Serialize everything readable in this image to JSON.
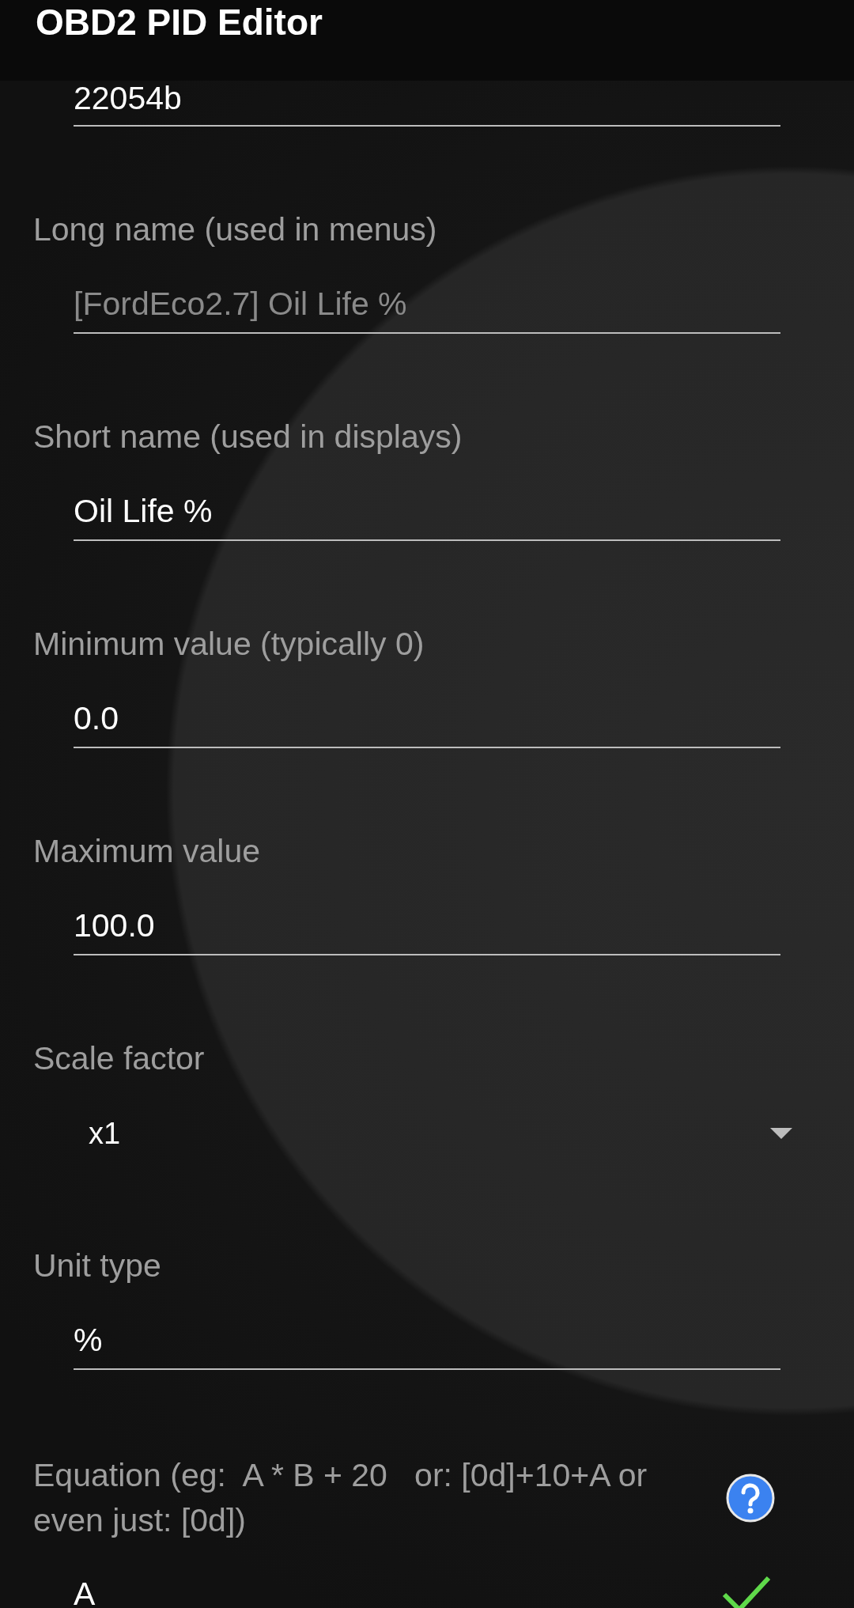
{
  "window": {
    "title": "OBD2 PID Editor"
  },
  "fields": [
    {
      "kind": "text",
      "value": "22054b"
    },
    {
      "kind": "text",
      "label": "Long name (used in menus)",
      "placeholder": "[FordEco2.7] Oil Life %"
    },
    {
      "kind": "text",
      "label": "Short name (used in displays)",
      "value": "Oil Life %"
    },
    {
      "kind": "text",
      "label": "Minimum value (typically 0)",
      "value": "0.0"
    },
    {
      "kind": "text",
      "label": "Maximum value",
      "value": "100.0"
    },
    {
      "kind": "dropdown",
      "label": "Scale factor",
      "value": "x1"
    },
    {
      "kind": "text",
      "label": "Unit type",
      "value": "%"
    },
    {
      "kind": "equation",
      "label": "Equation (eg:  A * B + 20   or: [0d]+10+A or even just: [0d])",
      "value": "A",
      "valid": true
    }
  ]
}
